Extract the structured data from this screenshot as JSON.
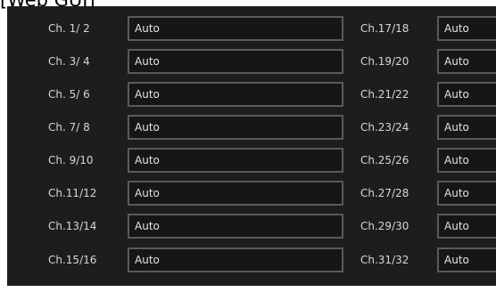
{
  "header": {
    "title": "[Web GUI]"
  },
  "left_column": [
    {
      "label": "Ch. 1/ 2",
      "value": "Auto"
    },
    {
      "label": "Ch. 3/ 4",
      "value": "Auto"
    },
    {
      "label": "Ch. 5/ 6",
      "value": "Auto"
    },
    {
      "label": "Ch. 7/ 8",
      "value": "Auto"
    },
    {
      "label": "Ch. 9/10",
      "value": "Auto"
    },
    {
      "label": "Ch.11/12",
      "value": "Auto"
    },
    {
      "label": "Ch.13/14",
      "value": "Auto"
    },
    {
      "label": "Ch.15/16",
      "value": "Auto"
    }
  ],
  "right_column": [
    {
      "label": "Ch.17/18",
      "value": "Auto"
    },
    {
      "label": "Ch.19/20",
      "value": "Auto"
    },
    {
      "label": "Ch.21/22",
      "value": "Auto"
    },
    {
      "label": "Ch.23/24",
      "value": "Auto"
    },
    {
      "label": "Ch.25/26",
      "value": "Auto"
    },
    {
      "label": "Ch.27/28",
      "value": "Auto"
    },
    {
      "label": "Ch.29/30",
      "value": "Auto"
    },
    {
      "label": "Ch.31/32",
      "value": "Auto"
    }
  ],
  "colors": {
    "panel_background": "#1d1d1d",
    "field_border": "#5a5a5a",
    "text": "#d6d6d6"
  }
}
